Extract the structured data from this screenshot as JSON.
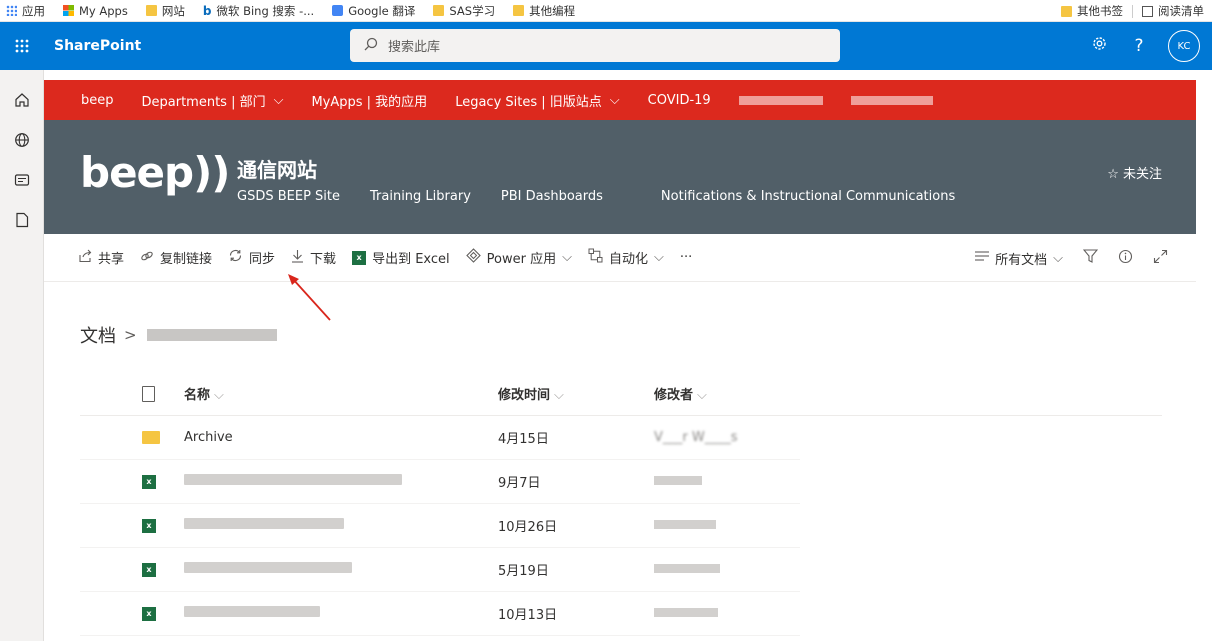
{
  "browser_bookmarks": {
    "items": [
      "应用",
      "My Apps",
      "网站",
      "微软 Bing 搜索 -...",
      "Google 翻译",
      "SAS学习",
      "其他编程"
    ],
    "right": [
      "其他书签",
      "阅读清单"
    ]
  },
  "suite": {
    "brand": "SharePoint",
    "search_placeholder": "搜索此库",
    "avatar_initials": "KC"
  },
  "hub_nav": {
    "items": [
      {
        "label": "beep"
      },
      {
        "label": "Departments | 部门",
        "chevron": true
      },
      {
        "label": "MyApps | 我的应用"
      },
      {
        "label": "Legacy Sites | 旧版站点",
        "chevron": true
      },
      {
        "label": "COVID-19"
      }
    ]
  },
  "site": {
    "logo_text": "beep))",
    "title": "通信网站",
    "nav": [
      "GSDS BEEP Site",
      "Training Library",
      "PBI Dashboards",
      "Notifications & Instructional Communications"
    ],
    "follow_label": "未关注"
  },
  "command_bar": {
    "share": "共享",
    "copy_link": "复制链接",
    "sync": "同步",
    "download": "下载",
    "export_excel": "导出到 Excel",
    "power_apps": "Power 应用",
    "automate": "自动化",
    "more": "···",
    "view": "所有文档"
  },
  "breadcrumb": {
    "root": "文档",
    "separator": ">"
  },
  "table": {
    "columns": {
      "name": "名称",
      "modified": "修改时间",
      "modified_by": "修改者"
    },
    "rows": [
      {
        "type": "folder",
        "name": "Archive",
        "modified": "4月15日",
        "modified_by": "V___r W____s"
      },
      {
        "type": "excel",
        "name": "",
        "modified": "9月7日",
        "modified_by": ""
      },
      {
        "type": "excel",
        "name": "",
        "modified": "10月26日",
        "modified_by": ""
      },
      {
        "type": "excel",
        "name": "",
        "modified": "5月19日",
        "modified_by": ""
      },
      {
        "type": "excel",
        "name": "",
        "modified": "10月13日",
        "modified_by": ""
      }
    ]
  },
  "colors": {
    "suite_bar": "#0078d4",
    "hub_nav": "#dc291e",
    "site_header": "#515f68",
    "excel_green": "#1d6f42",
    "folder_yellow": "#f5c542",
    "annotation_arrow": "#d9261c"
  }
}
